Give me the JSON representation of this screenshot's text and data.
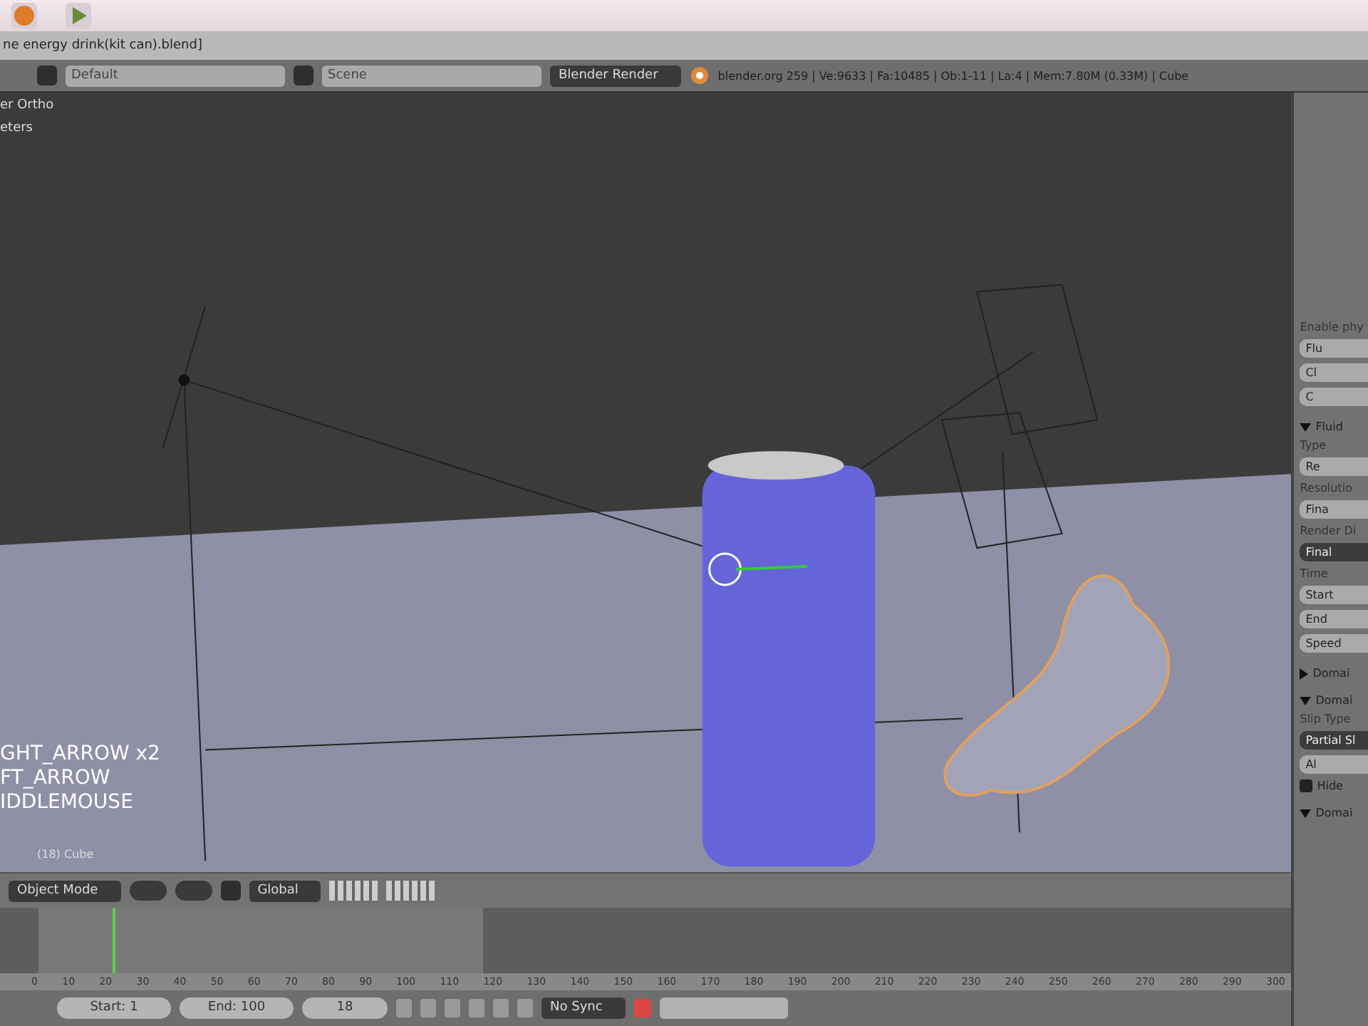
{
  "window": {
    "title": "ne energy drink(kit can).blend]"
  },
  "info_header": {
    "layout": "Default",
    "scene": "Scene",
    "renderer": "Blender Render",
    "stats": "blender.org 259 | Ve:9633 | Fa:10485 | Ob:1-11 | La:4 | Mem:7.80M (0.33M) | Cube"
  },
  "viewport": {
    "view_label": "er Ortho",
    "units_label": "eters",
    "key_log": [
      "GHT_ARROW x2",
      "FT_ARROW",
      "IDDLEMOUSE"
    ],
    "object_label": "(18) Cube"
  },
  "view_header": {
    "mode": "Object Mode",
    "orientation": "Global"
  },
  "timeline": {
    "ticks": [
      "0",
      "10",
      "20",
      "30",
      "40",
      "50",
      "60",
      "70",
      "80",
      "90",
      "100",
      "110",
      "120",
      "130",
      "140",
      "150",
      "160",
      "170",
      "180",
      "190",
      "200",
      "210",
      "220",
      "230",
      "240",
      "250",
      "260",
      "270",
      "280",
      "290",
      "300"
    ],
    "cursor": {
      "level": 0.06
    }
  },
  "playback": {
    "start": "Start: 1",
    "end": "End: 100",
    "frame": "18",
    "sync": "No Sync"
  },
  "properties": {
    "items": [
      {
        "kind": "label",
        "text": "Enable phy"
      },
      {
        "kind": "button",
        "text": "Flu"
      },
      {
        "kind": "button",
        "text": "Cl"
      },
      {
        "kind": "button",
        "text": "C"
      },
      {
        "kind": "section",
        "text": "Fluid",
        "expanded": true
      },
      {
        "kind": "label",
        "text": "Type"
      },
      {
        "kind": "button",
        "text": "Re"
      },
      {
        "kind": "label",
        "text": "Resolutio"
      },
      {
        "kind": "button",
        "text": "Fina"
      },
      {
        "kind": "label",
        "text": "Render Di"
      },
      {
        "kind": "dark",
        "text": "Final"
      },
      {
        "kind": "label",
        "text": "Time"
      },
      {
        "kind": "button",
        "text": "Start"
      },
      {
        "kind": "button",
        "text": "End"
      },
      {
        "kind": "button",
        "text": "Speed"
      },
      {
        "kind": "section",
        "text": "Domai",
        "expanded": false
      },
      {
        "kind": "section",
        "text": "Domai",
        "expanded": true
      },
      {
        "kind": "label",
        "text": "Slip Type"
      },
      {
        "kind": "dark",
        "text": "Partial Sl"
      },
      {
        "kind": "button",
        "text": "Al"
      },
      {
        "kind": "check",
        "text": "Hide",
        "checked": true
      },
      {
        "kind": "section",
        "text": "Domai",
        "expanded": true
      }
    ]
  }
}
